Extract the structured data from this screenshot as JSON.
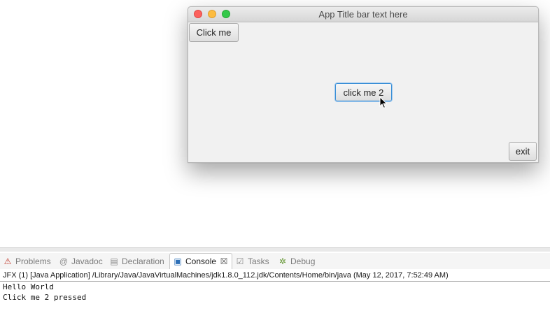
{
  "app_window": {
    "title": "App Title bar text here",
    "buttons": {
      "click_me": "Click me",
      "click_me_2": "click me 2",
      "exit": "exit"
    }
  },
  "ide": {
    "tabs": [
      {
        "label": "Problems",
        "icon": "problems-icon"
      },
      {
        "label": "Javadoc",
        "icon": "at-sign-icon"
      },
      {
        "label": "Declaration",
        "icon": "declaration-icon"
      },
      {
        "label": "Console",
        "icon": "console-icon",
        "active": true
      },
      {
        "label": "Tasks",
        "icon": "tasks-icon"
      },
      {
        "label": "Debug",
        "icon": "bug-icon"
      }
    ],
    "console": {
      "launch_info": "JFX (1) [Java Application] /Library/Java/JavaVirtualMachines/jdk1.8.0_112.jdk/Contents/Home/bin/java (May 12, 2017, 7:52:49 AM)",
      "output": [
        "Hello World",
        "Click me 2 pressed"
      ]
    }
  },
  "colors": {
    "focus_blue": "#3a8fd6",
    "close": "#fc605c",
    "minimize": "#fdbc40",
    "maximize": "#34c84a"
  }
}
